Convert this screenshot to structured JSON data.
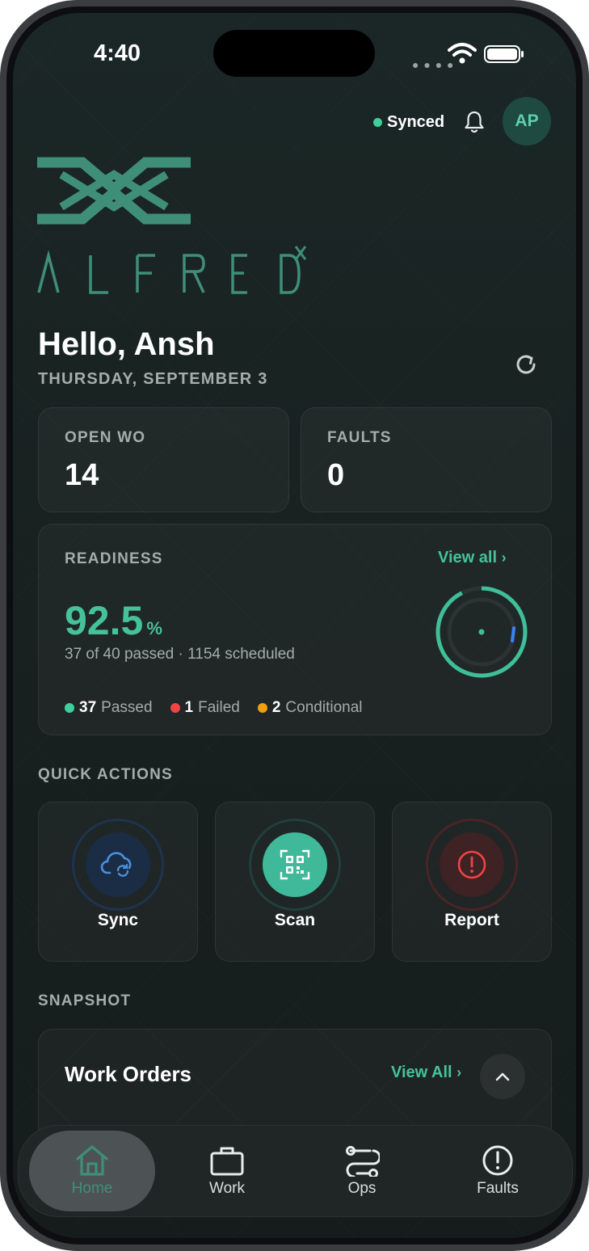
{
  "status_bar": {
    "time": "4:40",
    "icons": [
      "cellular-dots-icon",
      "wifi-icon",
      "battery-icon"
    ]
  },
  "header": {
    "sync_status": "Synced",
    "sync_color": "#3ecf9c",
    "avatar_initials": "AP",
    "icons": [
      "bell-icon"
    ]
  },
  "brand": {
    "logo_text": "ALFRED",
    "logo_superscript": "X",
    "accent": "#3f8f78"
  },
  "greeting": {
    "title": "Hello, Ansh",
    "date": "THURSDAY, SEPTEMBER 3"
  },
  "stats": [
    {
      "label": "OPEN WO",
      "value": "14"
    },
    {
      "label": "FAULTS",
      "value": "0"
    }
  ],
  "readiness": {
    "label": "READINESS",
    "view_all": "View all",
    "percent": "92.5",
    "percent_unit": "%",
    "summary": "37 of 40 passed · 1154 scheduled",
    "legend": [
      {
        "count": "37",
        "label": "Passed",
        "color": "#3ecf9c"
      },
      {
        "count": "1",
        "label": "Failed",
        "color": "#ef4444"
      },
      {
        "count": "2",
        "label": "Conditional",
        "color": "#f59e0b"
      }
    ],
    "gauge_fraction": 0.925
  },
  "quick_actions": {
    "label": "QUICK ACTIONS",
    "items": [
      {
        "label": "Sync",
        "icon": "cloud-sync-icon"
      },
      {
        "label": "Scan",
        "icon": "qr-code-icon"
      },
      {
        "label": "Report",
        "icon": "alert-circle-icon"
      }
    ]
  },
  "snapshot": {
    "label": "SNAPSHOT",
    "work_orders": {
      "title": "Work Orders",
      "view_all": "View All"
    }
  },
  "tabbar": {
    "active": "Home",
    "items": [
      {
        "label": "Home",
        "icon": "home-icon"
      },
      {
        "label": "Work",
        "icon": "briefcase-icon"
      },
      {
        "label": "Ops",
        "icon": "workflow-icon"
      },
      {
        "label": "Faults",
        "icon": "alert-circle-icon"
      }
    ]
  }
}
